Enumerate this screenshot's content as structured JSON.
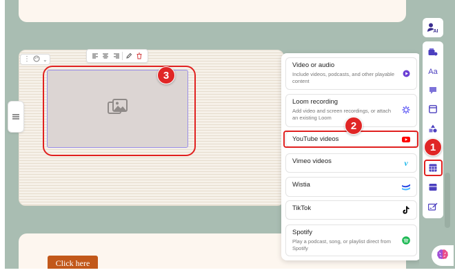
{
  "editor": {
    "cta_button": "Click here",
    "side_handle_icon": "menu-icon",
    "image_toolbar": [
      "align-left-icon",
      "align-center-icon",
      "align-right-icon",
      "pencil-icon",
      "trash-icon"
    ]
  },
  "embed_menu": {
    "items": [
      {
        "title": "Video or audio",
        "description": "Include videos, podcasts, and other playable content",
        "icon": "play-icon",
        "color": "#6b3fd4"
      },
      {
        "title": "Loom recording",
        "description": "Add video and screen recordings, or attach an existing Loom",
        "icon": "loom-icon",
        "color": "#625df5"
      },
      {
        "title": "YouTube videos",
        "description": "",
        "icon": "youtube-icon",
        "color": "#ff0000"
      },
      {
        "title": "Vimeo videos",
        "description": "",
        "icon": "vimeo-icon",
        "color": "#1ab7ea"
      },
      {
        "title": "Wistia",
        "description": "",
        "icon": "wistia-icon",
        "color": "#2949e5"
      },
      {
        "title": "TikTok",
        "description": "",
        "icon": "tiktok-icon",
        "color": "#000000"
      },
      {
        "title": "Spotify",
        "description": "Play a podcast, song, or playlist direct from Spotify",
        "icon": "spotify-icon",
        "color": "#1db954"
      }
    ]
  },
  "right_toolbar": {
    "ai_label": "AI",
    "text_label": "Aa",
    "icons": [
      "ai-assistant-icon",
      "media-icon",
      "text-icon",
      "comment-icon",
      "card-icon",
      "shapes-icon",
      "embed-icon",
      "layout-icon",
      "form-icon"
    ]
  },
  "callouts": [
    "1",
    "2",
    "3"
  ],
  "colors": {
    "highlight": "#e0201f",
    "cta": "#c2581a",
    "background": "#a9bdb2"
  }
}
